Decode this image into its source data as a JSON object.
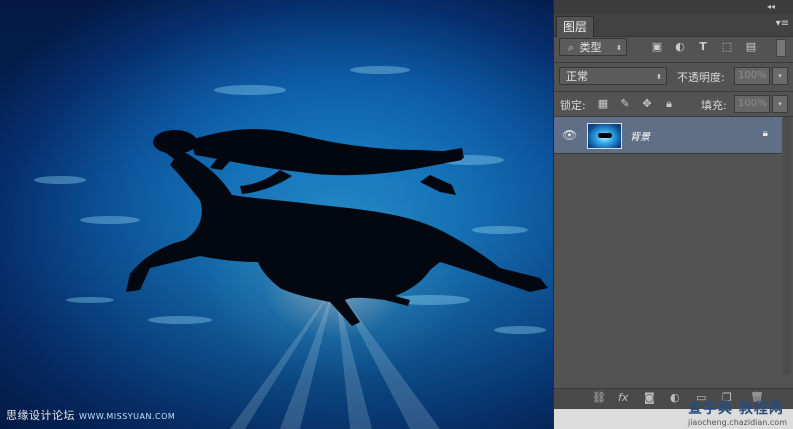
{
  "canvas": {
    "watermark": "思缘设计论坛",
    "watermark_url": "WWW.MISSYUAN.COM"
  },
  "panel": {
    "tab_label": "图层",
    "filter_label": "类型",
    "blend_mode": "正常",
    "opacity_label": "不透明度:",
    "opacity_value": "100%",
    "lock_label": "锁定:",
    "fill_label": "填充:",
    "fill_value": "100%",
    "layers": [
      {
        "name": "背景",
        "visible": true,
        "locked": true
      }
    ]
  },
  "site_watermark": {
    "text": "查字典 教程网",
    "url": "jiaocheng.chazidian.com"
  }
}
